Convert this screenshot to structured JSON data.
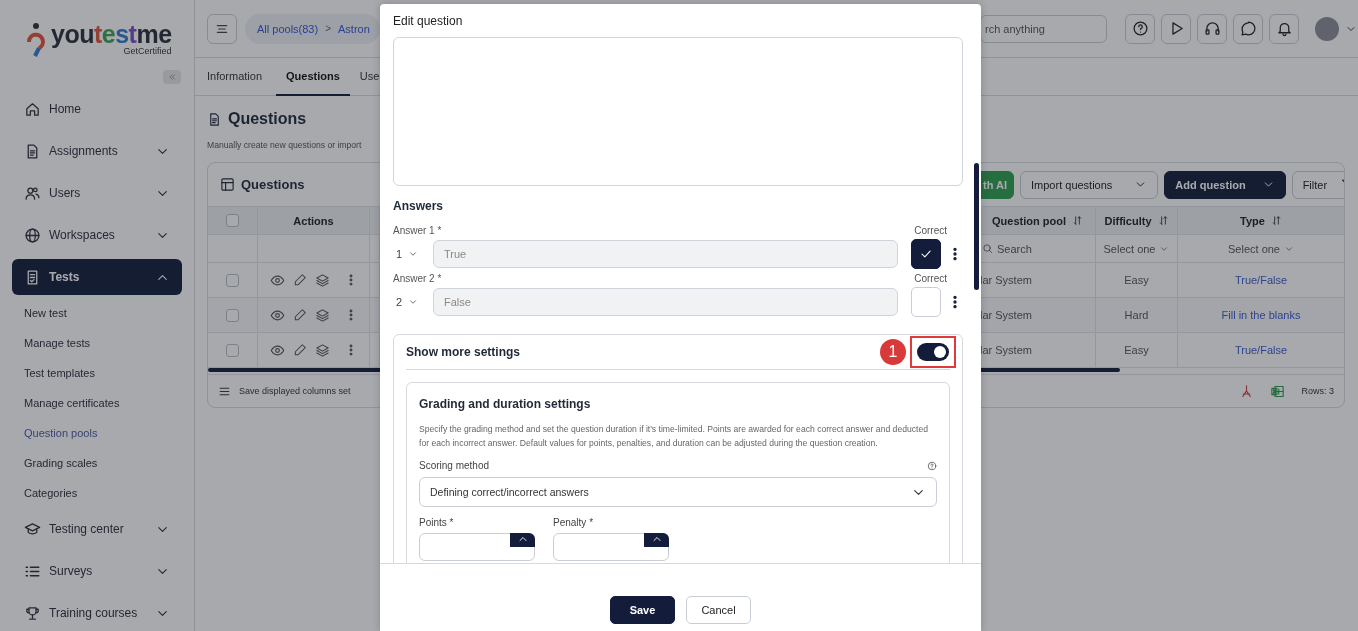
{
  "sidebar": {
    "logo": {
      "name": "youtestme",
      "tagline": "GetCertified"
    },
    "items": [
      {
        "label": "Home",
        "kind": "link",
        "selected": false
      },
      {
        "label": "Assignments",
        "kind": "group",
        "selected": false,
        "expanded": false
      },
      {
        "label": "Users",
        "kind": "group",
        "selected": false,
        "expanded": false
      },
      {
        "label": "Workspaces",
        "kind": "group",
        "selected": false,
        "expanded": false
      },
      {
        "label": "Tests",
        "kind": "group",
        "selected": true,
        "expanded": true,
        "children": [
          {
            "label": "New test",
            "selected": false
          },
          {
            "label": "Manage tests",
            "selected": false
          },
          {
            "label": "Test templates",
            "selected": false
          },
          {
            "label": "Manage certificates",
            "selected": false
          },
          {
            "label": "Question pools",
            "selected": true
          },
          {
            "label": "Grading scales",
            "selected": false
          },
          {
            "label": "Categories",
            "selected": false
          }
        ]
      },
      {
        "label": "Testing center",
        "kind": "group",
        "selected": false,
        "expanded": false
      },
      {
        "label": "Surveys",
        "kind": "group",
        "selected": false,
        "expanded": false
      },
      {
        "label": "Training courses",
        "kind": "group",
        "selected": false,
        "expanded": false
      }
    ]
  },
  "top_bar": {
    "breadcrumb": [
      "All pools(83)",
      ">",
      "Astron"
    ],
    "search": {
      "placeholder": "rch anything"
    }
  },
  "tabs": [
    {
      "label": "Information",
      "selected": false
    },
    {
      "label": "Questions",
      "selected": true
    },
    {
      "label": "Use",
      "selected": false
    }
  ],
  "page": {
    "title": "Questions",
    "description": "Manually create new questions or import"
  },
  "card": {
    "title": "Questions",
    "buttons": [
      {
        "label": "th AI",
        "kind": "ai"
      },
      {
        "label": "Import questions",
        "kind": "dropdown"
      },
      {
        "label": "Add question",
        "kind": "primary"
      },
      {
        "label": "Filter",
        "kind": "filter"
      }
    ]
  },
  "table": {
    "select_all": {
      "checked": false
    },
    "actions_header": "Actions",
    "columns": [
      {
        "label": "Question pool",
        "sortable": true
      },
      {
        "label": "Difficulty",
        "sortable": true
      },
      {
        "label": "Type",
        "sortable": true
      }
    ],
    "filters": [
      {
        "kind": "search",
        "placeholder": "Search"
      },
      {
        "kind": "select",
        "placeholder": "Select one"
      },
      {
        "kind": "select",
        "placeholder": "Select one"
      }
    ],
    "rows": [
      {
        "checked": false,
        "cells": [
          "lar System",
          "Easy",
          "True/False"
        ]
      },
      {
        "checked": false,
        "cells": [
          "lar System",
          "Hard",
          "Fill in the blanks"
        ]
      },
      {
        "checked": false,
        "cells": [
          "lar System",
          "Easy",
          "True/False"
        ]
      }
    ],
    "footer_action": "Save displayed columns set",
    "rows_count": "Rows: 3"
  },
  "modal": {
    "title": "Edit question",
    "answers_heading": "Answers",
    "answers": [
      {
        "label": "Answer 1 *",
        "order": "1",
        "value": "True",
        "correct_label": "Correct",
        "correct": true
      },
      {
        "label": "Answer 2 *",
        "order": "2",
        "value": "False",
        "correct_label": "Correct",
        "correct": false
      }
    ],
    "more_settings": {
      "label": "Show more settings",
      "on": true,
      "callout": "1"
    },
    "grading": {
      "title": "Grading and duration settings",
      "description": "Specify the grading method and set the question duration if it's time-limited. Points are awarded for each correct answer and deducted for each incorrect answer. Default values for points, penalties, and duration can be adjusted during the question creation.",
      "scoring_label": "Scoring method",
      "scoring_value": "Defining correct/incorrect answers",
      "points_label": "Points *",
      "penalty_label": "Penalty *"
    },
    "buttons": [
      {
        "label": "Save",
        "kind": "primary"
      },
      {
        "label": "Cancel",
        "kind": "secondary"
      }
    ]
  }
}
